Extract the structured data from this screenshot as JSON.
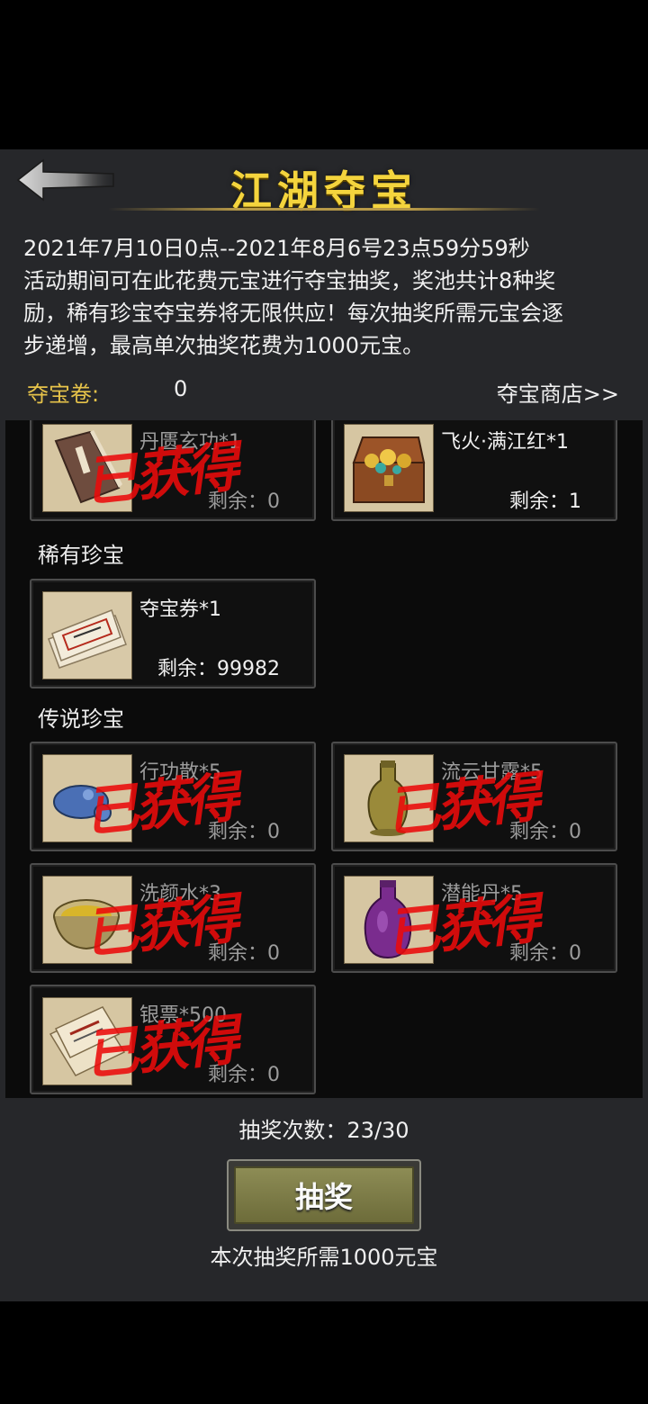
{
  "header": {
    "title": "江湖夺宝"
  },
  "description": {
    "period": "2021年7月10日0点--2021年8月6号23点59分59秒",
    "line1": "活动期间可在此花费元宝进行夺宝抽奖，奖池共计8种奖",
    "line2": "励，稀有珍宝夺宝券将无限供应！每次抽奖所需元宝会逐",
    "line3": "步递增，最高单次抽奖花费为1000元宝。"
  },
  "tickets": {
    "label": "夺宝卷:",
    "count": "0",
    "shop_link": "夺宝商店>>"
  },
  "stamp_text": "已获得",
  "sections": {
    "rare": "稀有珍宝",
    "legendary": "传说珍宝"
  },
  "items": [
    {
      "name": "丹匮玄功*1",
      "remain": "剩余：0",
      "obtained": true,
      "icon": "book-icon"
    },
    {
      "name": "飞火·满江红*1",
      "remain": "剩余：1",
      "obtained": false,
      "icon": "treasure-chest-icon"
    },
    {
      "name": "夺宝券*1",
      "remain": "剩余：99982",
      "obtained": false,
      "icon": "ticket-icon"
    },
    {
      "name": "行功散*5",
      "remain": "剩余：0",
      "obtained": true,
      "icon": "pill-pouch-icon"
    },
    {
      "name": "流云甘露*5",
      "remain": "剩余：0",
      "obtained": true,
      "icon": "wine-flask-icon"
    },
    {
      "name": "洗颜水*3",
      "remain": "剩余：0",
      "obtained": true,
      "icon": "bowl-icon"
    },
    {
      "name": "潜能丹*5",
      "remain": "剩余：0",
      "obtained": true,
      "icon": "purple-vase-icon"
    },
    {
      "name": "银票*500",
      "remain": "剩余：0",
      "obtained": true,
      "icon": "banknote-icon"
    }
  ],
  "draw": {
    "count_text": "抽奖次数：23/30",
    "button_label": "抽奖",
    "cost_text": "本次抽奖所需1000元宝"
  },
  "colors": {
    "title": "#f4d43d",
    "ticket_label": "#e6c34a",
    "stamp": "#eb0a0a",
    "button": "#8d8c55"
  }
}
